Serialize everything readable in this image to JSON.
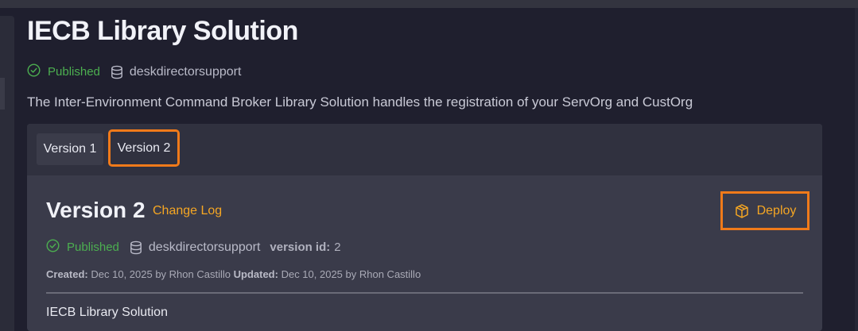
{
  "page": {
    "title": "IECB Library Solution",
    "status": "Published",
    "organization": "deskdirectorsupport",
    "description": "The Inter-Environment Command Broker Library Solution handles the registration of your ServOrg and CustOrg"
  },
  "tabs": [
    {
      "label": "Version 1",
      "selected": false
    },
    {
      "label": "Version 2",
      "selected": true
    }
  ],
  "version": {
    "title": "Version 2",
    "change_log_label": "Change Log",
    "deploy_label": "Deploy",
    "status": "Published",
    "organization": "deskdirectorsupport",
    "version_id_label": "version id:",
    "version_id": "2",
    "created_label": "Created:",
    "created_value": "Dec 10, 2025 by Rhon Castillo",
    "updated_label": "Updated:",
    "updated_value": "Dec 10, 2025 by Rhon Castillo",
    "subtitle": "IECB Library Solution"
  },
  "colors": {
    "accent": "#f5a623",
    "highlight": "#f07a1a",
    "success": "#4caf50"
  },
  "icons": {
    "status": "check-circle-icon",
    "organization": "database-icon",
    "deploy": "package-box-icon"
  }
}
